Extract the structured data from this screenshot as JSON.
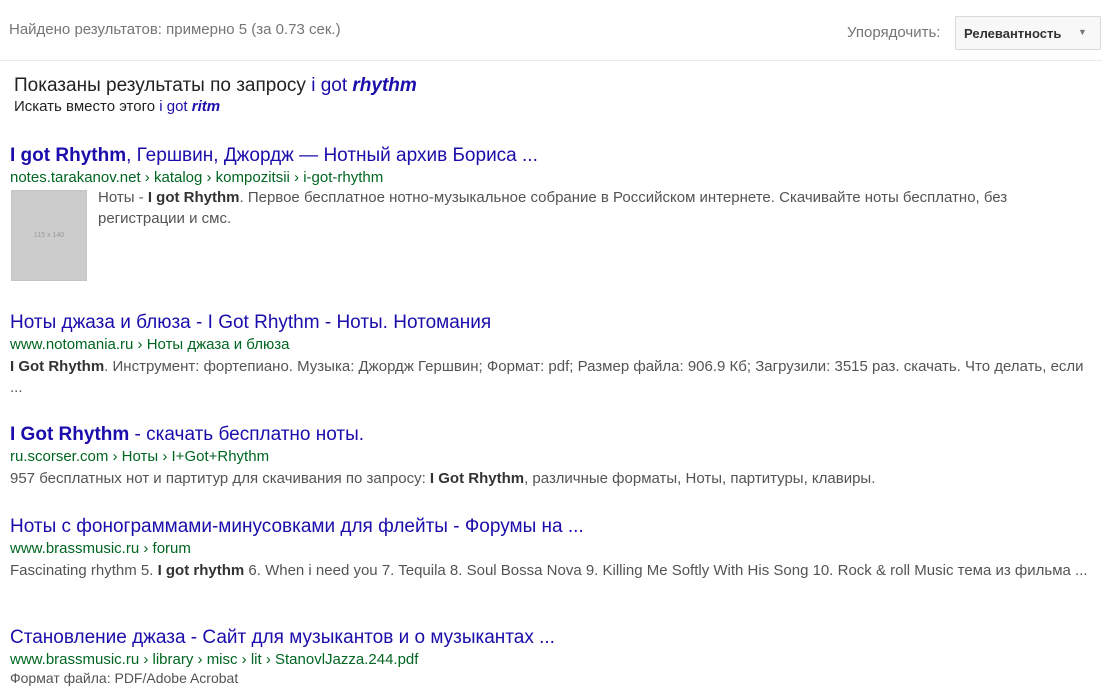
{
  "toolbar": {
    "result_count": "Найдено результатов: примерно 5 (за 0.73 сек.)",
    "sort_label": "Упорядочить:",
    "sort_value": "Релевантность"
  },
  "spelling": {
    "showing_prefix": "Показаны результаты по запросу ",
    "query_plain": "i got ",
    "query_bold": "rhythm",
    "instead_prefix": "Искать вместо этого ",
    "alt_plain": "i got ",
    "alt_bold": "ritm"
  },
  "results": [
    {
      "title_bold": "I got Rhythm",
      "title_rest": ", Гершвин, Джордж — Нотный архив Бориса ...",
      "url": "notes.tarakanov.net › katalog › kompozitsii › i-got-rhythm",
      "thumb_label": "115 x 140",
      "snippet_pre": "Ноты - ",
      "snippet_bold": "I got Rhythm",
      "snippet_post": ". Первое бесплатное нотно-музыкальное собрание в Российском интернете. Скачивайте ноты бесплатно, без регистрации и смс."
    },
    {
      "title": "Ноты джаза и блюза - I Got Rhythm - Ноты. Нотомания",
      "url": "www.notomania.ru › Ноты джаза и блюза",
      "snippet_bold": "I Got Rhythm",
      "snippet_post": ". Инструмент: фортепиано. Музыка: Джордж Гершвин; Формат: pdf; Размер файла: 906.9 Кб; Загрузили: 3515 раз. скачать. Что делать, если  ..."
    },
    {
      "title_bold": "I Got Rhythm",
      "title_rest": " - скачать бесплатно ноты.",
      "url": "ru.scorser.com › Ноты › I+Got+Rhythm",
      "snippet_pre": "957 бесплатных нот и партитур для скачивания по запросу: ",
      "snippet_bold": "I Got Rhythm",
      "snippet_post": ", различные форматы, Ноты, партитуры, клавиры."
    },
    {
      "title": "Ноты с фонограммами-минусовками для флейты - Форумы на ...",
      "url": "www.brassmusic.ru › forum",
      "snippet_pre": "Fascinating rhythm 5. ",
      "snippet_bold": "I got rhythm",
      "snippet_post": " 6. When i need you 7. Tequila 8. Soul Bossa Nova 9. Killing Me Softly With His Song 10. Rock & roll Music тема из фильма ..."
    },
    {
      "title": "Становление джаза - Сайт для музыкантов и о музыкантах ...",
      "url": "www.brassmusic.ru › library › misc › lit › StanovlJazza.244.pdf",
      "format": "Формат файла: PDF/Adobe Acrobat"
    }
  ]
}
